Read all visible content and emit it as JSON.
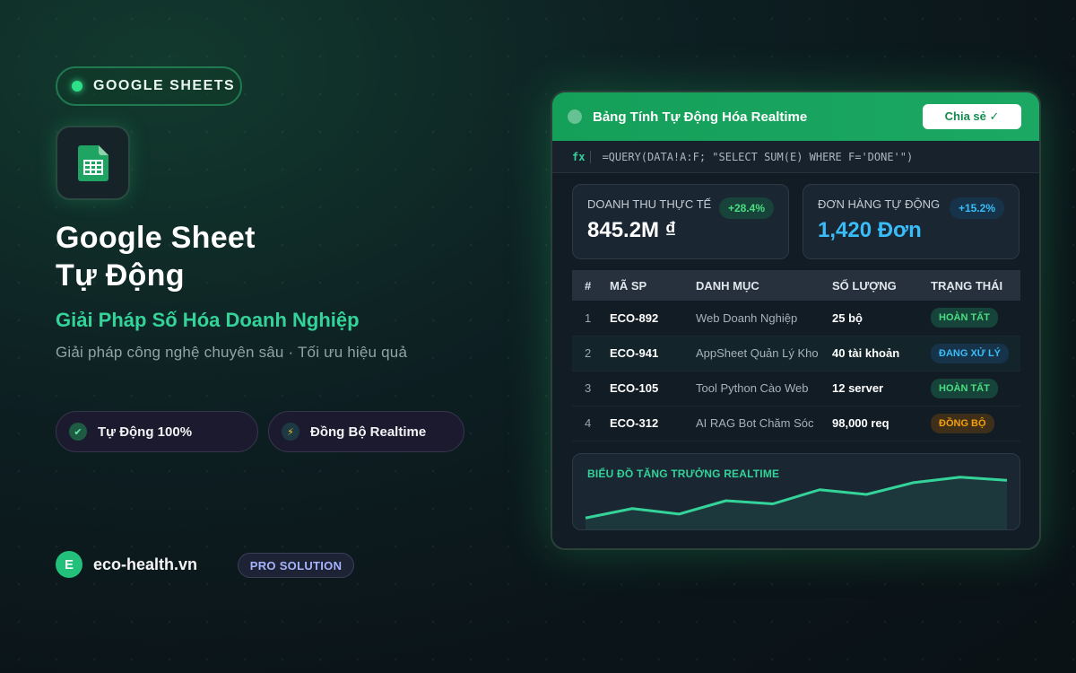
{
  "left": {
    "badge": "GOOGLE SHEETS",
    "title_line1": "Google Sheet",
    "title_line2": "Tự Động",
    "subtitle": "Giải Pháp Số Hóa Doanh Nghiệp",
    "tagline": "Giải pháp công nghệ chuyên sâu · Tối ưu hiệu quả",
    "features": [
      {
        "label": "Tự Động 100%",
        "icon": "check-icon"
      },
      {
        "label": "Đồng Bộ Realtime",
        "icon": "bolt-icon"
      }
    ],
    "brand_initial": "E",
    "brand_domain": "eco-health.vn",
    "pro_label": "PRO SOLUTION"
  },
  "panel": {
    "title": "Bảng Tính Tự Động Hóa Realtime",
    "share_label": "Chia sẻ ✓",
    "fx_label": "fx",
    "formula": "=QUERY(DATA!A:F; \"SELECT SUM(E) WHERE F='DONE'\")",
    "cards": [
      {
        "label": "DOANH THU THỰC TẾ",
        "value": "845.2M ₫",
        "change": "+28.4%"
      },
      {
        "label": "ĐƠN HÀNG TỰ ĐỘNG",
        "value": "1,420 Đơn",
        "change": "+15.2%"
      }
    ],
    "table": {
      "headers": [
        "#",
        "MÃ SP",
        "DANH MỤC",
        "SỐ LƯỢNG",
        "TRẠNG THÁI"
      ],
      "rows": [
        {
          "idx": "1",
          "code": "ECO-892",
          "category": "Web Doanh Nghiệp",
          "qty": "25 bộ",
          "status": "HOÀN TẤT"
        },
        {
          "idx": "2",
          "code": "ECO-941",
          "category": "AppSheet Quản Lý Kho",
          "qty": "40 tài khoản",
          "status": "ĐANG XỬ LÝ"
        },
        {
          "idx": "3",
          "code": "ECO-105",
          "category": "Tool Python Cào Web",
          "qty": "12 server",
          "status": "HOÀN TẤT"
        },
        {
          "idx": "4",
          "code": "ECO-312",
          "category": "AI RAG Bot Chăm Sóc",
          "qty": "98,000 req",
          "status": "ĐỒNG BỘ"
        }
      ]
    },
    "chart_title": "BIỂU ĐỒ TĂNG TRƯỞNG REALTIME"
  },
  "colors": {
    "accent": "#34d399",
    "header_green": "#15a05a",
    "blue": "#38bdf8",
    "orange": "#f59e0b"
  },
  "chart_data": {
    "type": "area",
    "title": "BIỂU ĐỒ TĂNG TRƯỞNG REALTIME",
    "values": [
      10,
      22,
      15,
      32,
      28,
      46,
      40,
      55,
      62,
      58
    ],
    "ylim": [
      0,
      80
    ],
    "grid": false
  }
}
